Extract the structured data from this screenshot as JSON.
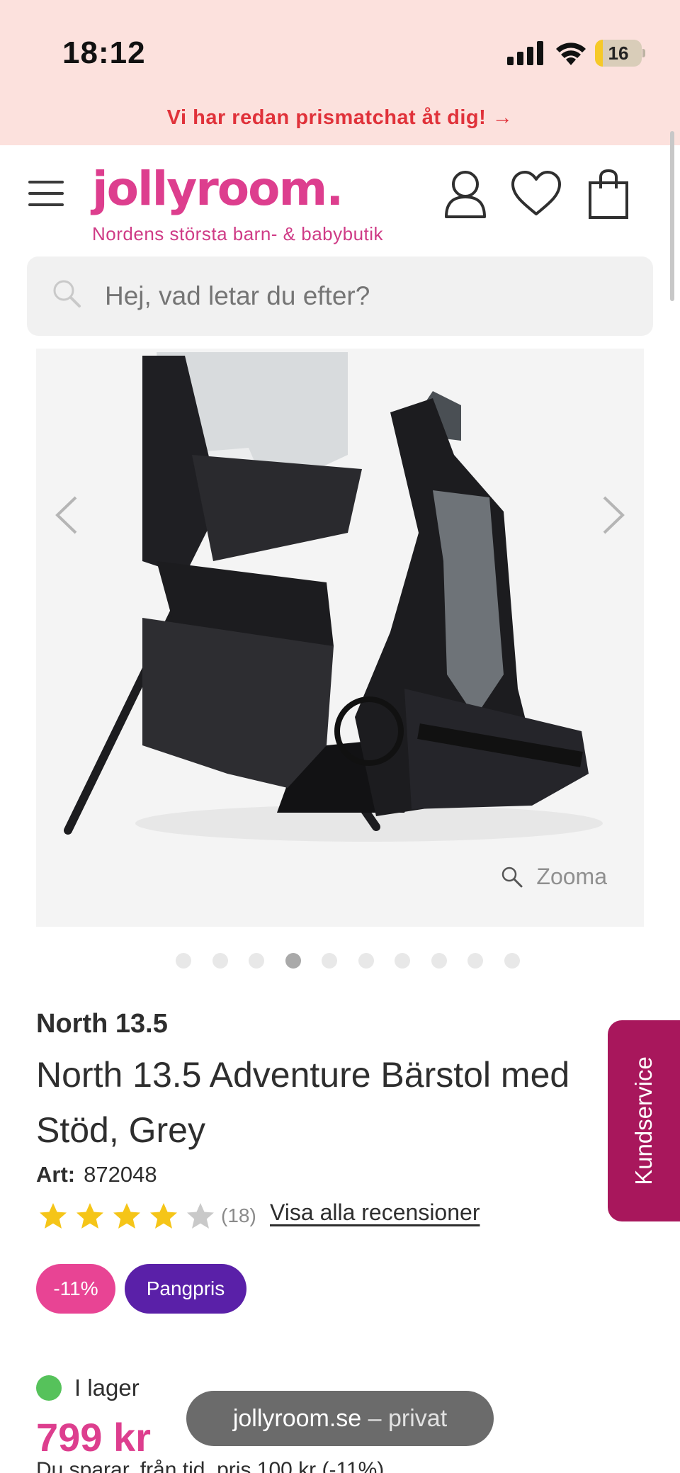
{
  "status_bar": {
    "time": "18:12",
    "battery": "16",
    "battery_level": 0.16
  },
  "promo_banner": {
    "text": "Vi har redan prismatchat åt dig! →"
  },
  "header": {
    "logo": "jollyroom.",
    "tagline": "Nordens största barn- & babybutik",
    "icons": [
      "menu-icon",
      "user-icon",
      "heart-icon",
      "cart-icon"
    ]
  },
  "search": {
    "placeholder": "Hej, vad letar du efter?"
  },
  "gallery": {
    "zoom_label": "Zooma",
    "dot_count": 10,
    "active_dot_index": 3
  },
  "product": {
    "brand": "North 13.5",
    "title": "North 13.5 Adventure Bärstol med Stöd, Grey",
    "art_label": "Art:",
    "art_number": "872048",
    "rating": 4,
    "rating_max": 5,
    "review_count": "(18)",
    "reviews_link": "Visa alla recensioner",
    "badges": {
      "discount": "-11%",
      "deal": "Pangpris"
    },
    "stock": "I lager",
    "price": "799 kr",
    "savings_text": "Du sparar, från tid. pris 100 kr (-11%)"
  },
  "kundservice": {
    "label": "Kundservice"
  },
  "browser": {
    "domain": "jollyroom.se",
    "mode": " – privat"
  },
  "colors": {
    "brand_pink": "#dd3e8e",
    "promo_red": "#e0323a",
    "deal_purple": "#5a20a8",
    "stock_green": "#56c25b",
    "kundservice": "#a8175c"
  }
}
